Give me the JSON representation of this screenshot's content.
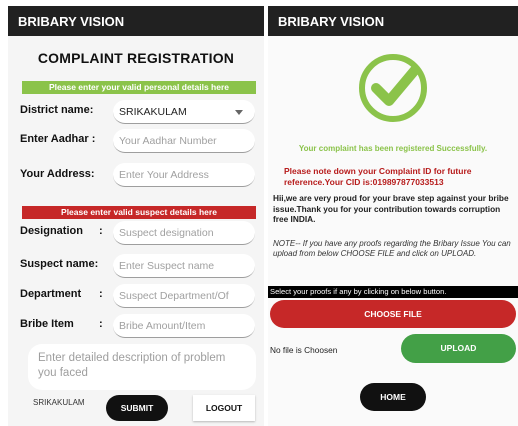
{
  "left_screen": {
    "app_title": "BRIBARY VISION",
    "form_title": "COMPLAINT REGISTRATION",
    "personal_banner": "Please enter your valid personal details here",
    "district": {
      "label": "District name:",
      "value": "SRIKAKULAM"
    },
    "aadhar": {
      "label": "Enter Aadhar :",
      "placeholder": "Your Aadhar Number"
    },
    "address": {
      "label": "Your Address:",
      "placeholder": "Enter Your Address"
    },
    "suspect_banner": "Please enter valid suspect details here",
    "designation": {
      "label": "Designation",
      "colon": ":",
      "placeholder": "Suspect designation"
    },
    "suspect_name": {
      "label": "Suspect name:",
      "placeholder": "Enter Suspect name"
    },
    "department": {
      "label": "Department",
      "colon": ":",
      "placeholder": "Suspect Department/Of"
    },
    "bribe_item": {
      "label": "Bribe Item",
      "colon": ":",
      "placeholder": "Bribe Amount/Item"
    },
    "description_placeholder": "Enter detailed description of problem you faced",
    "district_footer": "SRIKAKULAM",
    "submit_label": "SUBMIT",
    "logout_label": "LOGOUT"
  },
  "right_screen": {
    "app_title": "BRIBARY VISION",
    "success_message": "Your complaint has been registered Successfully.",
    "cid_message": "Please note down your Complaint ID for future reference.Your CID is:019897877033513",
    "thanks_message": "Hii,we are very proud for your brave step against your bribe issue.Thank you for your contribution towards corruption free INDIA.",
    "note_message": "NOTE-- If you have any proofs regarding the Bribary Issue You can upload from below CHOOSE FILE and click on UPLOAD.",
    "select_proofs": "Select your proofs if any by clicking on below button.",
    "choose_file_label": "CHOOSE FILE",
    "no_file_text": "No file is Choosen",
    "upload_label": "UPLOAD",
    "home_label": "HOME"
  },
  "icons": {
    "success": "check-circle-icon",
    "dropdown": "chevron-down-icon"
  },
  "colors": {
    "appbar": "#212121",
    "success_green": "#8bc34a",
    "alert_red": "#c62828",
    "upload_green": "#43a047"
  }
}
